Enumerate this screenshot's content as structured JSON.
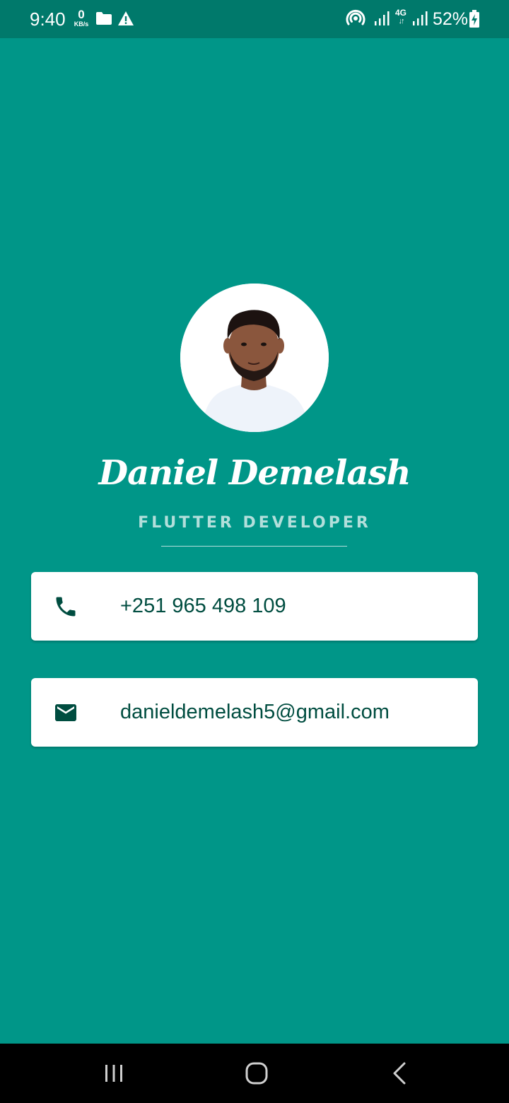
{
  "status_bar": {
    "time": "9:40",
    "net_speed_value": "0",
    "net_speed_unit": "KB/s",
    "network_type": "4G",
    "battery_percent": "52%",
    "icons": [
      "folder-icon",
      "alert-icon",
      "hotspot-icon",
      "signal-icon",
      "signal-icon",
      "battery-icon"
    ]
  },
  "profile": {
    "name": "Daniel Demelash",
    "role": "FLUTTER DEVELOPER"
  },
  "contacts": [
    {
      "icon": "phone-icon",
      "value": "+251 965 498 109"
    },
    {
      "icon": "email-icon",
      "value": "danieldemelash5@gmail.com"
    }
  ],
  "colors": {
    "background": "#009688",
    "status_bar": "#00796b",
    "card": "#ffffff",
    "card_text": "#004d40",
    "role_text": "#b2dfdb",
    "nav_bar": "#000000"
  },
  "nav_bar": {
    "buttons": [
      "recents-icon",
      "home-icon",
      "back-icon"
    ]
  }
}
